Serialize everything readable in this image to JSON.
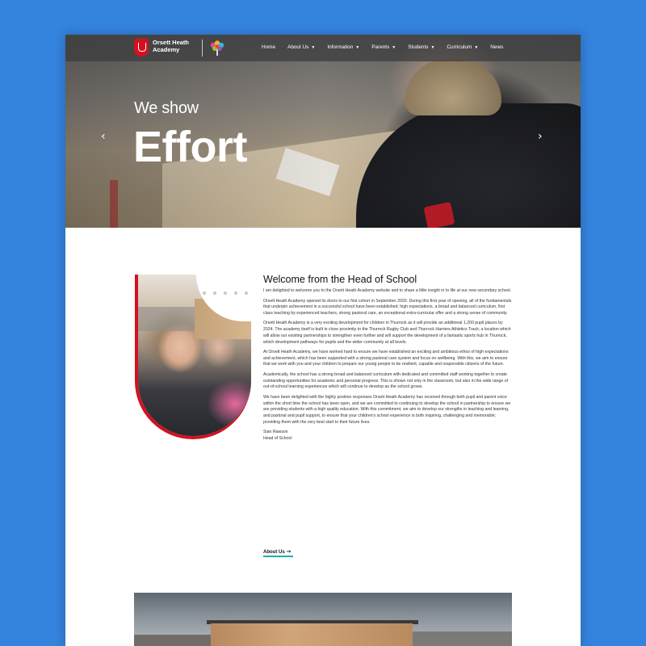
{
  "nav": {
    "logo_text": "Orsett Heath Academy",
    "items": [
      {
        "label": "Home",
        "has_dropdown": false
      },
      {
        "label": "About Us",
        "has_dropdown": true
      },
      {
        "label": "Information",
        "has_dropdown": true
      },
      {
        "label": "Parents",
        "has_dropdown": true
      },
      {
        "label": "Students",
        "has_dropdown": true
      },
      {
        "label": "Curriculum",
        "has_dropdown": true
      },
      {
        "label": "News",
        "has_dropdown": false
      }
    ]
  },
  "hero": {
    "small_text": "We show",
    "big_text": "Effort",
    "prev_arrow": "‹",
    "next_arrow": "›"
  },
  "welcome": {
    "title": "Welcome from the Head of School",
    "paragraphs": [
      "I am delighted to welcome you to the Orsett Heath Academy website and to share a little insight in to life at our new secondary school.",
      "Orsett Heath Academy opened its doors to our first cohort in September 2020. During this first year of opening, all of the fundamentals that underpin achievement in a successful school have been established; high expectations, a broad and balanced curriculum, first class teaching by experienced teachers, strong pastoral care, an exceptional extra-curricular offer and a strong sense of community.",
      "Orsett Heath Academy is a very exciting development for children in Thurrock as it will provide an additional 1,200 pupil places by 2024. The academy itself is built in close proximity to the Thurrock Rugby Club and Thurrock Harriers Athletics Track; a location which will allow our existing partnerships to strengthen even further and will support the development of a fantastic sports hub in Thurrock, which development pathways for pupils and the wider community at all levels.",
      "At Orsett Heath Academy, we have worked hard to ensure we have established an exciting and ambitious ethos of high expectations and achievement, which has been supported with a strong pastoral care system and focus on wellbeing. With this, we aim to ensure that we work with you and your children to prepare our young people to be resilient, capable and responsible citizens of the future.",
      "Academically, the school has a strong broad and balanced curriculum with dedicated and committed staff working together to create outstanding opportunities for academic and personal progress. This is shown not only in the classroom, but also in the wide range of out-of-school learning experiences which will continue to develop as the school grows.",
      "We have been delighted with the highly positive responses Orsett Heath Academy has received through both pupil and parent voice within the short time the school has been open, and we are committed to continuing to develop the school in partnership to ensure we are providing students with a high quality education. With this commitment, we aim to develop our strengths in teaching and learning, and pastoral and pupil support, to ensure that your children's school experience is both inspiring, challenging and memorable; providing them with the very best start to their future lives."
    ],
    "signature_name": "Sian Rawson",
    "signature_title": "Head of School",
    "about_link": "About Us"
  },
  "colors": {
    "page_background": "#3483dd",
    "brand_red": "#d4111f",
    "link_underline": "#1ab0b0"
  }
}
